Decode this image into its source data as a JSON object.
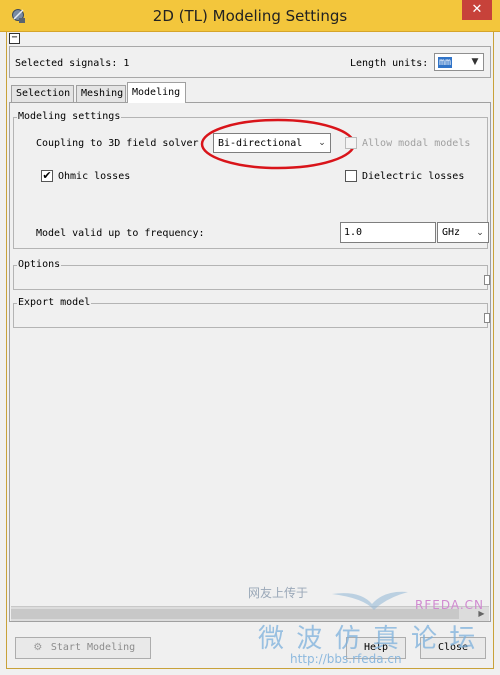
{
  "window": {
    "title": "2D (TL) Modeling Settings",
    "close_glyph": "✕",
    "icon": "satellite-dish-icon"
  },
  "header": {
    "collapse_glyph": "−",
    "selected_signals": "Selected signals: 1",
    "length_units_label": "Length units:",
    "length_units_value": "mm"
  },
  "tabs": [
    {
      "label": "Selection"
    },
    {
      "label": "Meshing"
    },
    {
      "label": "Modeling"
    }
  ],
  "active_tab": "Modeling",
  "modeling_settings": {
    "title": "Modeling settings",
    "coupling_label": "Coupling to 3D field solver",
    "coupling_value": "Bi-directional",
    "allow_modal_label": "Allow modal models",
    "allow_modal_checked": false,
    "allow_modal_enabled": false,
    "ohmic_label": "Ohmic losses",
    "ohmic_checked": true,
    "ohmic_check_glyph": "✔",
    "dielectric_label": "Dielectric losses",
    "dielectric_checked": false,
    "freq_label": "Model valid up to frequency:",
    "freq_value": "1.0",
    "freq_unit": "GHz"
  },
  "options": {
    "title": "Options"
  },
  "export_model": {
    "title": "Export model"
  },
  "footer": {
    "start_label": "Start Modeling",
    "help_label": "Help",
    "close_label": "Close"
  },
  "watermark": {
    "line1": "网友上传于",
    "site": "RFEDA.CN",
    "line2": "微 波 仿 真 论 坛",
    "url": "http://bbs.rfeda.cn"
  },
  "colors": {
    "titlebar": "#f3c63c",
    "close_button": "#c7423a",
    "highlight_ellipse": "#d9141a",
    "selection": "#3174c8"
  }
}
